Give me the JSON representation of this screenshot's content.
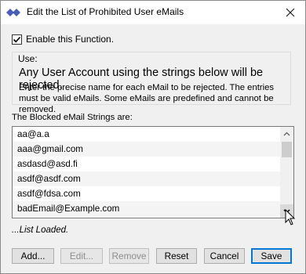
{
  "window": {
    "title": "Edit the List of Prohibited User eMails",
    "app_icon": "double-diamond-icon",
    "close_icon": "close-icon"
  },
  "enable": {
    "label": "Enable this Function.",
    "checked": true
  },
  "use_group": {
    "title": "Use:",
    "main_text": "Any User Account using the strings below will be rejected.",
    "description": "Enter the precise name for each eMail to be rejected. The entries must be valid eMails. Some eMails are predefined and cannot be removed."
  },
  "list": {
    "heading": "The Blocked eMail Strings are:",
    "items": [
      "aa@a.a",
      "aaa@gmail.com",
      "asdasd@asd.fi",
      "asdf@asdf.com",
      "asdf@fdsa.com",
      "badEmail@Example.com"
    ],
    "scroll_level": 0.15
  },
  "status": "...List Loaded.",
  "buttons": {
    "add": "Add...",
    "edit": "Edit...",
    "remove": "Remove",
    "reset": "Reset",
    "cancel": "Cancel",
    "save": "Save"
  },
  "colors": {
    "accent": "#0078d7",
    "app_icon": "#4a5eb7"
  }
}
